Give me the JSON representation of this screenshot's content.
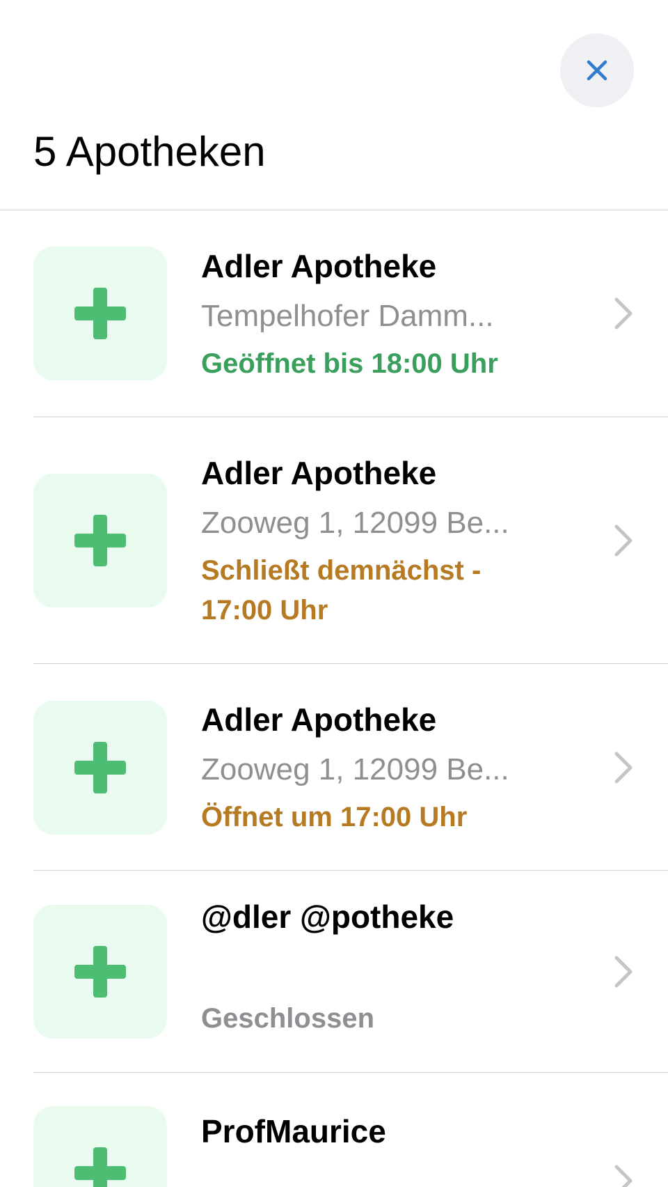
{
  "header": {
    "title": "5 Apotheken",
    "close_icon": "close-icon"
  },
  "colors": {
    "accent": "#2f7ccc",
    "open": "#3a9f5d",
    "warning": "#b57a22",
    "closed": "#8e8e93",
    "thumb_bg": "#e8fbee",
    "cross": "#4cbd73"
  },
  "pharmacies": [
    {
      "name": "Adler Apotheke",
      "address": "Tempelhofer Damm...",
      "status": "Geöffnet bis 18:00 Uhr",
      "status_kind": "open",
      "icon": "pharmacy-cross-icon"
    },
    {
      "name": "Adler Apotheke",
      "address": "Zooweg 1, 12099 Be...",
      "status": "Schließt demnächst - 17:00 Uhr",
      "status_kind": "warning",
      "icon": "pharmacy-cross-icon"
    },
    {
      "name": "Adler Apotheke",
      "address": "Zooweg 1, 12099 Be...",
      "status": "Öffnet um 17:00 Uhr",
      "status_kind": "warning",
      "icon": "pharmacy-cross-icon"
    },
    {
      "name": "@dler @potheke",
      "address": "",
      "status": "Geschlossen",
      "status_kind": "closed",
      "icon": "pharmacy-cross-icon"
    },
    {
      "name": "ProfMaurice",
      "address": "",
      "status": "",
      "status_kind": "",
      "icon": "pharmacy-cross-icon"
    }
  ]
}
